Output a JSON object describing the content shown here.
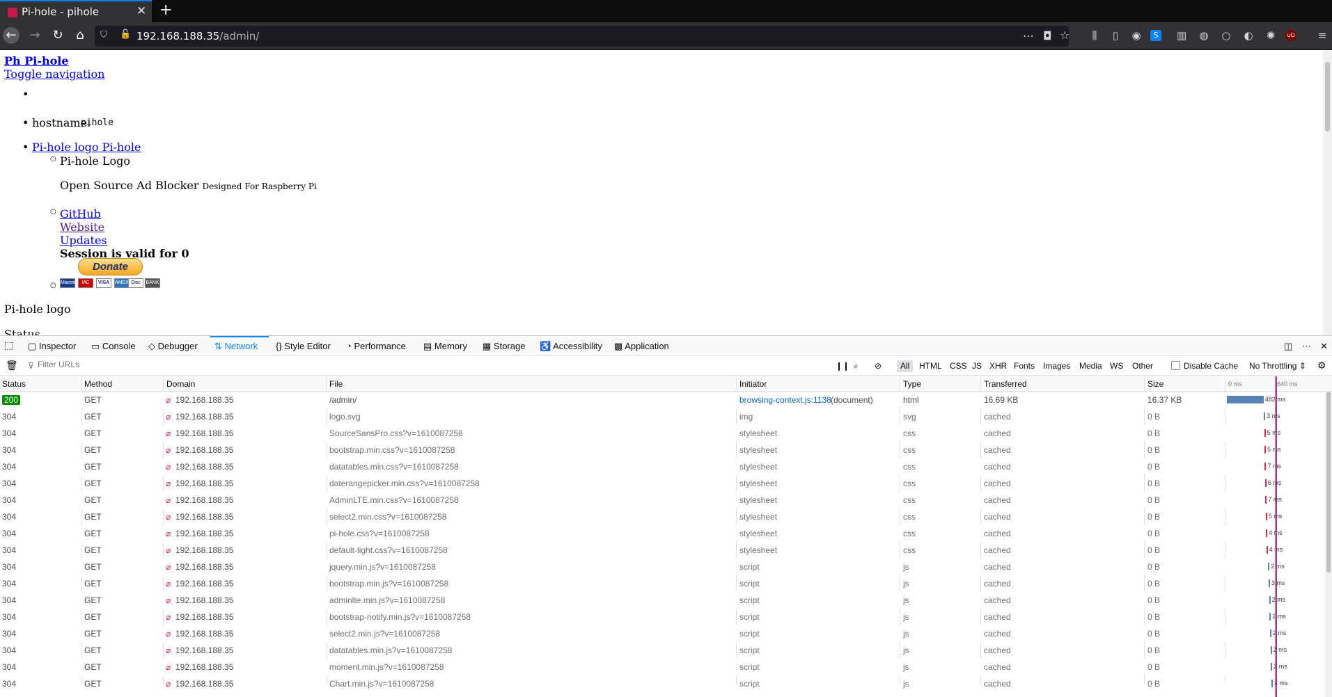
{
  "browser": {
    "tab_title": "Pi-hole - pihole",
    "url_host": "192.168.188.35",
    "url_path": "/admin/"
  },
  "page": {
    "logo_link": "Ph Pi-hole",
    "toggle_nav": "Toggle navigation",
    "hostname_label": "hostname:",
    "hostname_value": "pihole",
    "brand_link": "Pi-hole logo Pi-hole",
    "logo_text": "Pi-hole Logo",
    "tagline": "Open Source Ad Blocker",
    "tagline_small": "Designed For Raspberry Pi",
    "links": [
      "GitHub",
      "Website",
      "Updates"
    ],
    "session": "Session is valid for 0",
    "donate": "Donate",
    "cards": [
      "Maestro",
      "MC",
      "VISA",
      "AMEX",
      "Disc",
      "BANK"
    ],
    "footer_logo": "Pi-hole logo",
    "status": "Status"
  },
  "devtools": {
    "tabs": [
      "Inspector",
      "Console",
      "Debugger",
      "Network",
      "Style Editor",
      "Performance",
      "Memory",
      "Storage",
      "Accessibility",
      "Application"
    ],
    "filter_placeholder": "Filter URLs",
    "filters": [
      "All",
      "HTML",
      "CSS",
      "JS",
      "XHR",
      "Fonts",
      "Images",
      "Media",
      "WS",
      "Other"
    ],
    "disable_cache": "Disable Cache",
    "throttling": "No Throttling",
    "columns": [
      "Status",
      "Method",
      "Domain",
      "File",
      "Initiator",
      "Type",
      "Transferred",
      "Size"
    ],
    "waterfall_ticks": [
      "0 ms",
      "640 ms"
    ],
    "rows": [
      {
        "status": "200",
        "method": "GET",
        "domain": "192.168.188.35",
        "file": "/admin/",
        "initiator": "browsing-context.js:1138",
        "initiator_extra": "(document)",
        "type": "html",
        "transferred": "16.69 KB",
        "size": "16.37 KB",
        "time": "482 ms"
      },
      {
        "status": "304",
        "method": "GET",
        "domain": "192.168.188.35",
        "file": "logo.svg",
        "initiator": "img",
        "type": "svg",
        "transferred": "cached",
        "size": "0 B",
        "time": "3 ms"
      },
      {
        "status": "304",
        "method": "GET",
        "domain": "192.168.188.35",
        "file": "SourceSansPro.css?v=1610087258",
        "initiator": "stylesheet",
        "type": "css",
        "transferred": "cached",
        "size": "0 B",
        "time": "5 ms"
      },
      {
        "status": "304",
        "method": "GET",
        "domain": "192.168.188.35",
        "file": "bootstrap.min.css?v=1610087258",
        "initiator": "stylesheet",
        "type": "css",
        "transferred": "cached",
        "size": "0 B",
        "time": "5 ms"
      },
      {
        "status": "304",
        "method": "GET",
        "domain": "192.168.188.35",
        "file": "datatables.min.css?v=1610087258",
        "initiator": "stylesheet",
        "type": "css",
        "transferred": "cached",
        "size": "0 B",
        "time": "7 ms"
      },
      {
        "status": "304",
        "method": "GET",
        "domain": "192.168.188.35",
        "file": "daterangepicker.min.css?v=1610087258",
        "initiator": "stylesheet",
        "type": "css",
        "transferred": "cached",
        "size": "0 B",
        "time": "6 ms"
      },
      {
        "status": "304",
        "method": "GET",
        "domain": "192.168.188.35",
        "file": "AdminLTE.min.css?v=1610087258",
        "initiator": "stylesheet",
        "type": "css",
        "transferred": "cached",
        "size": "0 B",
        "time": "7 ms"
      },
      {
        "status": "304",
        "method": "GET",
        "domain": "192.168.188.35",
        "file": "select2.min.css?v=1610087258",
        "initiator": "stylesheet",
        "type": "css",
        "transferred": "cached",
        "size": "0 B",
        "time": "5 ms"
      },
      {
        "status": "304",
        "method": "GET",
        "domain": "192.168.188.35",
        "file": "pi-hole.css?v=1610087258",
        "initiator": "stylesheet",
        "type": "css",
        "transferred": "cached",
        "size": "0 B",
        "time": "4 ms"
      },
      {
        "status": "304",
        "method": "GET",
        "domain": "192.168.188.35",
        "file": "default-light.css?v=1610087258",
        "initiator": "stylesheet",
        "type": "css",
        "transferred": "cached",
        "size": "0 B",
        "time": "4 ms"
      },
      {
        "status": "304",
        "method": "GET",
        "domain": "192.168.188.35",
        "file": "jquery.min.js?v=1610087258",
        "initiator": "script",
        "type": "js",
        "transferred": "cached",
        "size": "0 B",
        "time": "2 ms"
      },
      {
        "status": "304",
        "method": "GET",
        "domain": "192.168.188.35",
        "file": "bootstrap.min.js?v=1610087258",
        "initiator": "script",
        "type": "js",
        "transferred": "cached",
        "size": "0 B",
        "time": "3 ms"
      },
      {
        "status": "304",
        "method": "GET",
        "domain": "192.168.188.35",
        "file": "adminlte.min.js?v=1610087258",
        "initiator": "script",
        "type": "js",
        "transferred": "cached",
        "size": "0 B",
        "time": "2 ms"
      },
      {
        "status": "304",
        "method": "GET",
        "domain": "192.168.188.35",
        "file": "bootstrap-notify.min.js?v=1610087258",
        "initiator": "script",
        "type": "js",
        "transferred": "cached",
        "size": "0 B",
        "time": "2 ms"
      },
      {
        "status": "304",
        "method": "GET",
        "domain": "192.168.188.35",
        "file": "select2.min.js?v=1610087258",
        "initiator": "script",
        "type": "js",
        "transferred": "cached",
        "size": "0 B",
        "time": "2 ms"
      },
      {
        "status": "304",
        "method": "GET",
        "domain": "192.168.188.35",
        "file": "datatables.min.js?v=1610087258",
        "initiator": "script",
        "type": "js",
        "transferred": "cached",
        "size": "0 B",
        "time": "2 ms"
      },
      {
        "status": "304",
        "method": "GET",
        "domain": "192.168.188.35",
        "file": "moment.min.js?v=1610087258",
        "initiator": "script",
        "type": "js",
        "transferred": "cached",
        "size": "0 B",
        "time": "2 ms"
      },
      {
        "status": "304",
        "method": "GET",
        "domain": "192.168.188.35",
        "file": "Chart.min.js?v=1610087258",
        "initiator": "script",
        "type": "js",
        "transferred": "cached",
        "size": "0 B",
        "time": "2 ms"
      }
    ]
  }
}
